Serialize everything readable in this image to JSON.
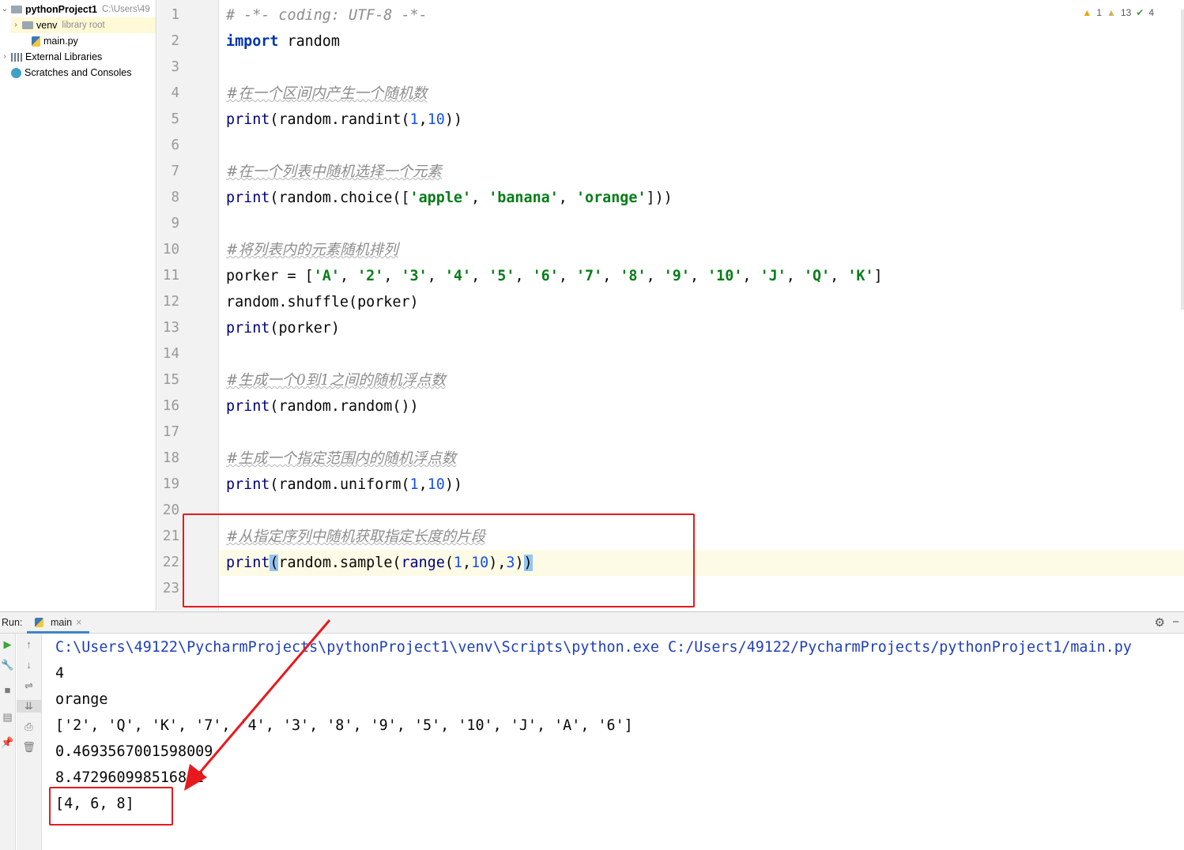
{
  "project_tree": {
    "root_name": "pythonProject1",
    "root_path": "C:\\Users\\49",
    "venv_label": "venv",
    "venv_note": "library root",
    "main_file": "main.py",
    "external_libraries": "External Libraries",
    "scratches": "Scratches and Consoles"
  },
  "inspections": {
    "errors": "1",
    "warnings": "13",
    "typos": "4",
    "error_icon": "warning-triangle-icon",
    "weak_icon": "weak-warning-icon",
    "typo_icon": "check-icon"
  },
  "line_numbers": [
    "1",
    "2",
    "3",
    "4",
    "5",
    "6",
    "7",
    "8",
    "9",
    "10",
    "11",
    "12",
    "13",
    "14",
    "15",
    "16",
    "17",
    "18",
    "19",
    "20",
    "21",
    "22",
    "23"
  ],
  "code": {
    "l1": "# -*- coding: UTF-8 -*-",
    "l2_kw": "import",
    "l2_mod": " random",
    "c4": "#在一个区间内产生一个随机数",
    "c7": "#在一个列表中随机选择一个元素",
    "c10": "#将列表内的元素随机排列",
    "c15": "#生成一个0到1之间的随机浮点数",
    "c18": "#生成一个指定范围内的随机浮点数",
    "c21": "#从指定序列中随机获取指定长度的片段",
    "print": "print",
    "random_randint": "(random.randint(",
    "random_choice": "(random.choice([",
    "random_random": "(random.random())",
    "random_uniform": "(random.uniform(",
    "random_sample": "random.sample(",
    "range": "range",
    "n1": "1",
    "n10": "10",
    "n3": "3",
    "comma": ",",
    "close2": "))",
    "apple": "'apple'",
    "banana": "'banana'",
    "orange": "'orange'",
    "sep": ", ",
    "close_list": "]))",
    "porker_assign": "porker = [",
    "cards": [
      "'A'",
      "'2'",
      "'3'",
      "'4'",
      "'5'",
      "'6'",
      "'7'",
      "'8'",
      "'9'",
      "'10'",
      "'J'",
      "'Q'",
      "'K'"
    ],
    "list_end": "]",
    "shuffle": "random.shuffle(porker)",
    "print_porker_args": "(porker)",
    "paren_open": "(",
    "paren_close": ")",
    "range_close": "),"
  },
  "run_panel": {
    "label": "Run:",
    "tab": "main",
    "tab_close": "×",
    "settings_icon": "gear-icon",
    "hide_icon": "minimize-icon"
  },
  "console_output": [
    "C:\\Users\\49122\\PycharmProjects\\pythonProject1\\venv\\Scripts\\python.exe C:/Users/49122/PycharmProjects/pythonProject1/main.py",
    "4",
    "orange",
    "['2', 'Q', 'K', '7', '4', '3', '8', '9', '5', '10', 'J', 'A', '6']",
    "0.4693567001598009",
    "8.472960998516852",
    "[4, 6, 8]"
  ],
  "colors": {
    "annotation_red": "#e8191d",
    "keyword": "#0033b3",
    "string": "#067d17",
    "number": "#1750eb",
    "comment": "#8c8c8c",
    "current_line": "#fdfbe5"
  }
}
